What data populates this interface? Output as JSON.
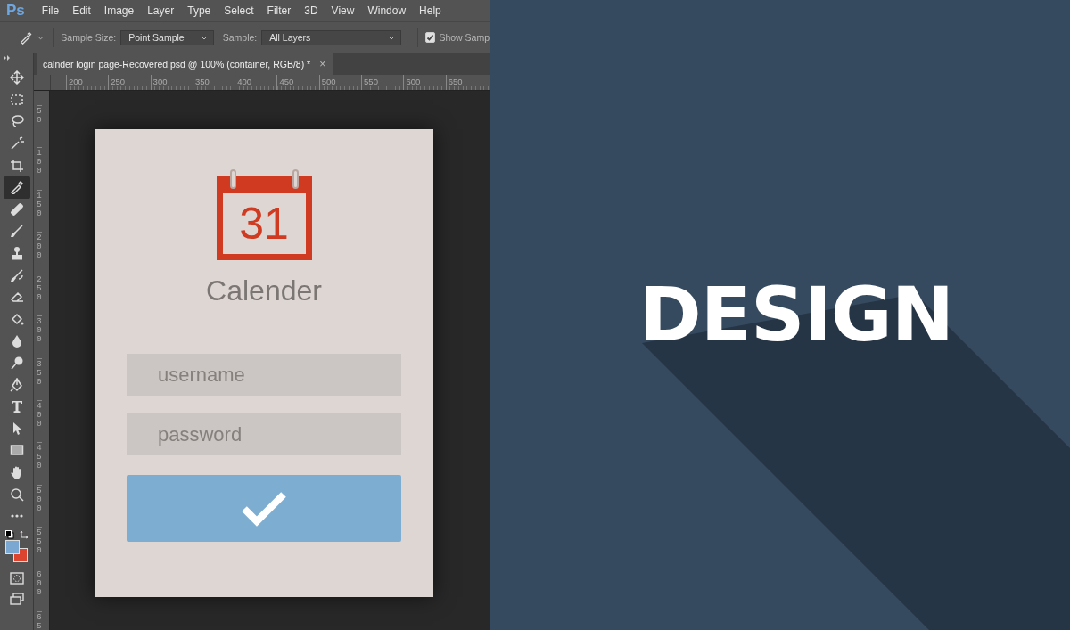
{
  "app": {
    "logo": "Ps"
  },
  "menu": [
    "File",
    "Edit",
    "Image",
    "Layer",
    "Type",
    "Select",
    "Filter",
    "3D",
    "View",
    "Window",
    "Help"
  ],
  "options_bar": {
    "sample_size_label": "Sample Size:",
    "sample_size": "Point Sample",
    "sample_label": "Sample:",
    "sample": "All Layers",
    "show_sampling": {
      "label": "Show Samp",
      "checked": true
    }
  },
  "document_tab": {
    "title": "calnder login page-Recovered.psd @ 100% (container, RGB/8) *",
    "close": "×"
  },
  "rulers": {
    "horizontal": [
      "200",
      "250",
      "300",
      "350",
      "400",
      "450",
      "500",
      "550",
      "600",
      "650"
    ],
    "vertical": [
      "50",
      "100",
      "150",
      "200",
      "250",
      "300",
      "350",
      "400",
      "450",
      "500",
      "550",
      "600",
      "65"
    ]
  },
  "tools": [
    {
      "selected": false
    },
    {
      "selected": false
    },
    {
      "selected": false
    },
    {
      "selected": false
    },
    {
      "selected": false
    },
    {
      "selected": true
    },
    {
      "selected": false
    },
    {
      "selected": false
    },
    {
      "selected": false
    },
    {
      "selected": false
    },
    {
      "selected": false
    },
    {
      "selected": false
    },
    {
      "selected": false
    },
    {
      "selected": false
    },
    {
      "selected": false
    },
    {
      "selected": false
    },
    {
      "selected": false
    },
    {
      "selected": false
    },
    {
      "selected": false
    },
    {
      "selected": false
    },
    {
      "selected": false
    }
  ],
  "swatches": [
    {
      "color": "#7ba8d2"
    },
    {
      "color": "#dc4430"
    }
  ],
  "artboard": {
    "calendar_day": "31",
    "title": "Calender",
    "username_placeholder": "username",
    "password_placeholder": "password"
  },
  "banner": {
    "text": "DESIGN"
  }
}
